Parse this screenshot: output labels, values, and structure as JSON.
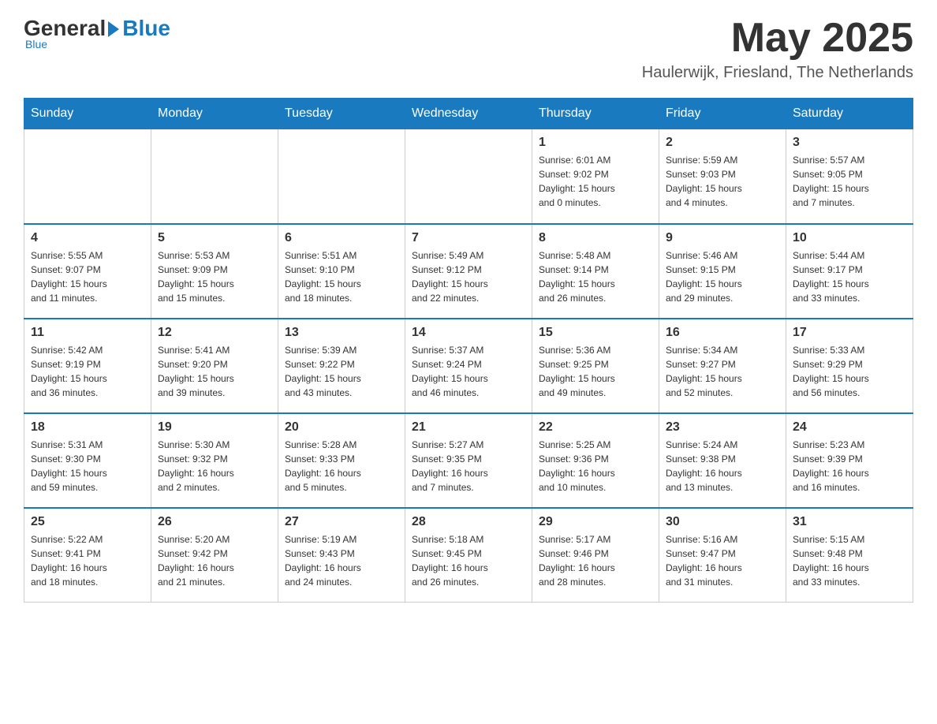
{
  "header": {
    "logo": {
      "general": "General",
      "blue": "Blue",
      "subtitle": "Blue"
    },
    "title": "May 2025",
    "location": "Haulerwijk, Friesland, The Netherlands"
  },
  "calendar": {
    "days_of_week": [
      "Sunday",
      "Monday",
      "Tuesday",
      "Wednesday",
      "Thursday",
      "Friday",
      "Saturday"
    ],
    "weeks": [
      [
        {
          "day": "",
          "info": ""
        },
        {
          "day": "",
          "info": ""
        },
        {
          "day": "",
          "info": ""
        },
        {
          "day": "",
          "info": ""
        },
        {
          "day": "1",
          "info": "Sunrise: 6:01 AM\nSunset: 9:02 PM\nDaylight: 15 hours\nand 0 minutes."
        },
        {
          "day": "2",
          "info": "Sunrise: 5:59 AM\nSunset: 9:03 PM\nDaylight: 15 hours\nand 4 minutes."
        },
        {
          "day": "3",
          "info": "Sunrise: 5:57 AM\nSunset: 9:05 PM\nDaylight: 15 hours\nand 7 minutes."
        }
      ],
      [
        {
          "day": "4",
          "info": "Sunrise: 5:55 AM\nSunset: 9:07 PM\nDaylight: 15 hours\nand 11 minutes."
        },
        {
          "day": "5",
          "info": "Sunrise: 5:53 AM\nSunset: 9:09 PM\nDaylight: 15 hours\nand 15 minutes."
        },
        {
          "day": "6",
          "info": "Sunrise: 5:51 AM\nSunset: 9:10 PM\nDaylight: 15 hours\nand 18 minutes."
        },
        {
          "day": "7",
          "info": "Sunrise: 5:49 AM\nSunset: 9:12 PM\nDaylight: 15 hours\nand 22 minutes."
        },
        {
          "day": "8",
          "info": "Sunrise: 5:48 AM\nSunset: 9:14 PM\nDaylight: 15 hours\nand 26 minutes."
        },
        {
          "day": "9",
          "info": "Sunrise: 5:46 AM\nSunset: 9:15 PM\nDaylight: 15 hours\nand 29 minutes."
        },
        {
          "day": "10",
          "info": "Sunrise: 5:44 AM\nSunset: 9:17 PM\nDaylight: 15 hours\nand 33 minutes."
        }
      ],
      [
        {
          "day": "11",
          "info": "Sunrise: 5:42 AM\nSunset: 9:19 PM\nDaylight: 15 hours\nand 36 minutes."
        },
        {
          "day": "12",
          "info": "Sunrise: 5:41 AM\nSunset: 9:20 PM\nDaylight: 15 hours\nand 39 minutes."
        },
        {
          "day": "13",
          "info": "Sunrise: 5:39 AM\nSunset: 9:22 PM\nDaylight: 15 hours\nand 43 minutes."
        },
        {
          "day": "14",
          "info": "Sunrise: 5:37 AM\nSunset: 9:24 PM\nDaylight: 15 hours\nand 46 minutes."
        },
        {
          "day": "15",
          "info": "Sunrise: 5:36 AM\nSunset: 9:25 PM\nDaylight: 15 hours\nand 49 minutes."
        },
        {
          "day": "16",
          "info": "Sunrise: 5:34 AM\nSunset: 9:27 PM\nDaylight: 15 hours\nand 52 minutes."
        },
        {
          "day": "17",
          "info": "Sunrise: 5:33 AM\nSunset: 9:29 PM\nDaylight: 15 hours\nand 56 minutes."
        }
      ],
      [
        {
          "day": "18",
          "info": "Sunrise: 5:31 AM\nSunset: 9:30 PM\nDaylight: 15 hours\nand 59 minutes."
        },
        {
          "day": "19",
          "info": "Sunrise: 5:30 AM\nSunset: 9:32 PM\nDaylight: 16 hours\nand 2 minutes."
        },
        {
          "day": "20",
          "info": "Sunrise: 5:28 AM\nSunset: 9:33 PM\nDaylight: 16 hours\nand 5 minutes."
        },
        {
          "day": "21",
          "info": "Sunrise: 5:27 AM\nSunset: 9:35 PM\nDaylight: 16 hours\nand 7 minutes."
        },
        {
          "day": "22",
          "info": "Sunrise: 5:25 AM\nSunset: 9:36 PM\nDaylight: 16 hours\nand 10 minutes."
        },
        {
          "day": "23",
          "info": "Sunrise: 5:24 AM\nSunset: 9:38 PM\nDaylight: 16 hours\nand 13 minutes."
        },
        {
          "day": "24",
          "info": "Sunrise: 5:23 AM\nSunset: 9:39 PM\nDaylight: 16 hours\nand 16 minutes."
        }
      ],
      [
        {
          "day": "25",
          "info": "Sunrise: 5:22 AM\nSunset: 9:41 PM\nDaylight: 16 hours\nand 18 minutes."
        },
        {
          "day": "26",
          "info": "Sunrise: 5:20 AM\nSunset: 9:42 PM\nDaylight: 16 hours\nand 21 minutes."
        },
        {
          "day": "27",
          "info": "Sunrise: 5:19 AM\nSunset: 9:43 PM\nDaylight: 16 hours\nand 24 minutes."
        },
        {
          "day": "28",
          "info": "Sunrise: 5:18 AM\nSunset: 9:45 PM\nDaylight: 16 hours\nand 26 minutes."
        },
        {
          "day": "29",
          "info": "Sunrise: 5:17 AM\nSunset: 9:46 PM\nDaylight: 16 hours\nand 28 minutes."
        },
        {
          "day": "30",
          "info": "Sunrise: 5:16 AM\nSunset: 9:47 PM\nDaylight: 16 hours\nand 31 minutes."
        },
        {
          "day": "31",
          "info": "Sunrise: 5:15 AM\nSunset: 9:48 PM\nDaylight: 16 hours\nand 33 minutes."
        }
      ]
    ]
  }
}
